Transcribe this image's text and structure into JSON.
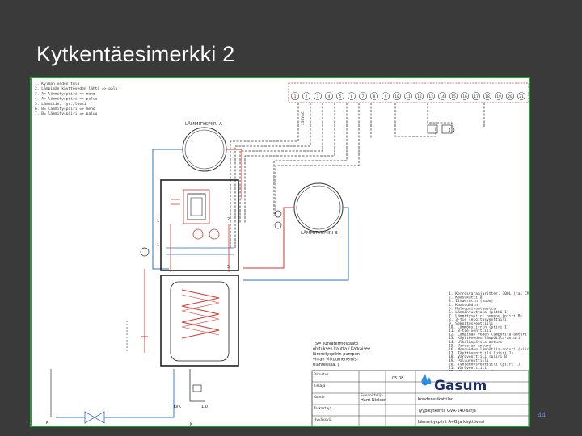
{
  "slide": {
    "title": "Kytkentäesimerkki 2",
    "page_number": "44"
  },
  "legend_top_left": [
    "1. Kylmän veden tulo",
    "2. Lämpimän käyttöveden lähtö => palu",
    "3. A= lämmityspiiri => meno",
    "4. A= lämmityspiiri => paluu",
    "5. Lämmitin, tyt./loesi",
    "6. B= lämmityspiiri => meno",
    "7. B= lämmityspiiri => paluu"
  ],
  "labels": {
    "circuit_a": "LÄMMITYSPIIRI A",
    "circuit_b": "LÄMMITYSPIIRI B",
    "lvk": "LVK",
    "lvk_value": "1.0",
    "voltage": "230VAC"
  },
  "terminals": [
    "1",
    "2",
    "3",
    "4",
    "5",
    "6",
    "7",
    "8",
    "9",
    "10",
    "11",
    "12",
    "13",
    "14",
    "15",
    "16",
    "17",
    "18",
    "19",
    "20",
    "21"
  ],
  "components_list": [
    "1. Kerrosvaraajaritter. 300L (tai CM-WE)",
    "2. Kaasukattila",
    "3. Ilmaerotin (huom)",
    "4. Kaasuuhdin",
    "5. Kalvopaisuntaastia",
    "6. Lämmöntuottaja (pitkä 1)",
    "7. Lämmityspiiri pumppu (piiri B)",
    "8. 3-tie sekoitusventtiili",
    "9. Sekoitusventtiili",
    "10. Lämmönsiirrin (piiri 1)",
    "11. 3-tie venttiili",
    "12. Lämpimän veden lämpötila-anturi",
    "13. Käyttöveden lämpötila-anturi",
    "14. Ulkolämpötila-anturi",
    "15. Varaajan anturi",
    "16. Menoveden lämpötila-anturi (piiri B)",
    "17. Täyttöventtiili (piiri 1)",
    "18. Varoventtiili (piiri B)",
    "19. Paluuventtiili",
    "20. Tyhjennysventtiili (piiri 1)",
    "21. Varoventtiili",
    "22. Käyttövesivaraaja"
  ],
  "note_text": [
    "TS= Turvatermostaatti",
    "ohituksen kautta / Katkaisee",
    "lämmityspiirin pumpun",
    "virran ylikuumenemis-",
    "tilanteessa. ("
  ],
  "title_block": {
    "brand": "Gasum",
    "drawn_label": "Suunnittelija",
    "drawn_value": "Harri Nielsen",
    "date_value": "05.08",
    "doc_type": "Kondenssikattilan",
    "project": "Tyypikytkentä GVR-140-sarja",
    "subject": "Lämmityspiirit A+B ja käyttövesi",
    "row_labels": [
      "Piirustus",
      "Tilaaja",
      "Kohde",
      "Tarkastaja",
      "Hyväksyjä"
    ]
  },
  "colors": {
    "background": "#3a3a3a",
    "diagram_border": "#2e9a3a",
    "supply": "#d9312b",
    "return": "#2e6fbf",
    "brand": "#1e2f6e",
    "page_number": "#6a8cd6"
  }
}
